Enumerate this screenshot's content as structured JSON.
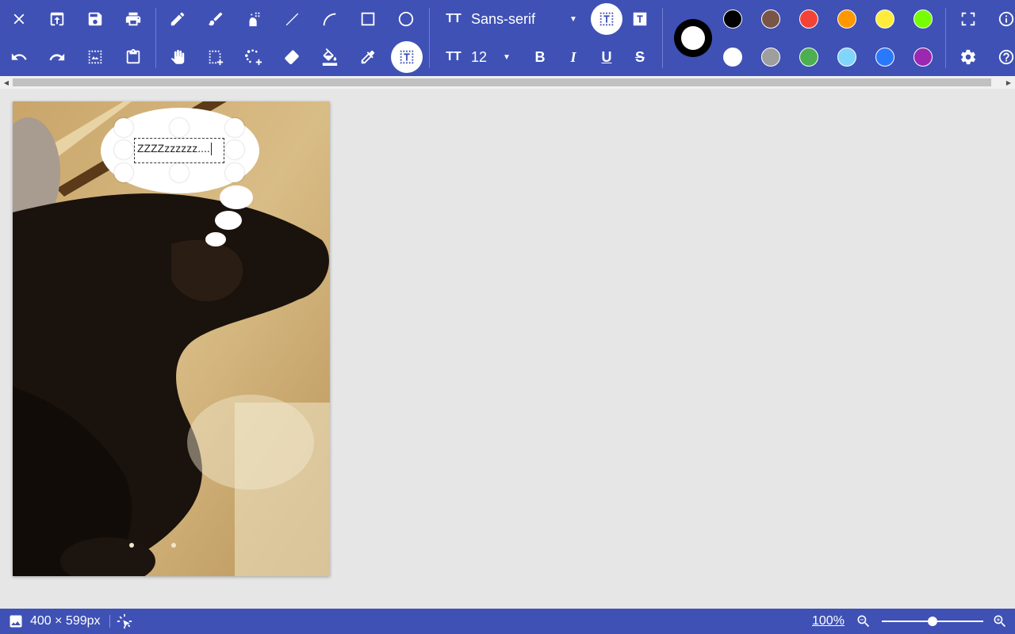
{
  "toolbar": {
    "font_family": "Sans-serif",
    "font_size": "12",
    "font_icon_label": "TT",
    "format": {
      "bold": "B",
      "italic": "I",
      "underline": "U",
      "strike": "S"
    },
    "palette_row1": [
      "#000000",
      "#795548",
      "#f44336",
      "#ff9800",
      "#ffeb3b",
      "#76ff03"
    ],
    "palette_row2": [
      "#ffffff",
      "#9e9e9e",
      "#4caf50",
      "#81d4fa",
      "#2979ff",
      "#9c27b0"
    ],
    "current_color": {
      "outline": "#000000",
      "fill": "#ffffff"
    },
    "accent": "#3f51b5"
  },
  "canvas": {
    "bubble_text": "ZZZZzzzzzz...."
  },
  "status": {
    "image_size": "400 × 599px",
    "zoom": "100%"
  }
}
